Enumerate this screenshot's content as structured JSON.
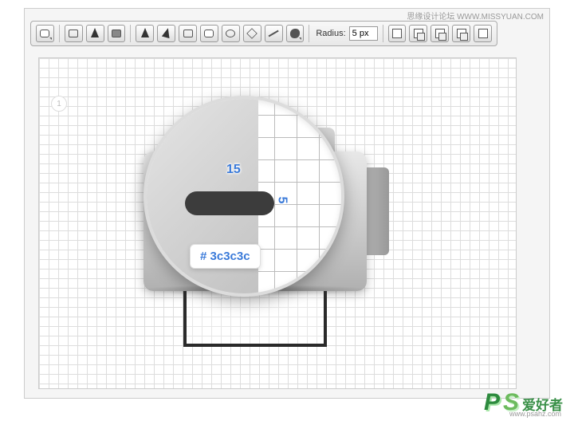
{
  "watermark": {
    "text_cn": "思缘设计论坛",
    "text_url": "WWW.MISSYUAN.COM"
  },
  "toolbar": {
    "radius_label": "Radius:",
    "radius_value": "5 px"
  },
  "step_badge": "1",
  "magnify": {
    "label_w": "15",
    "label_h": "5",
    "hex": "# 3c3c3c"
  },
  "footer": {
    "p": "P",
    "s": "S",
    "cn": "爱好者",
    "url": "www.psahz.com"
  }
}
